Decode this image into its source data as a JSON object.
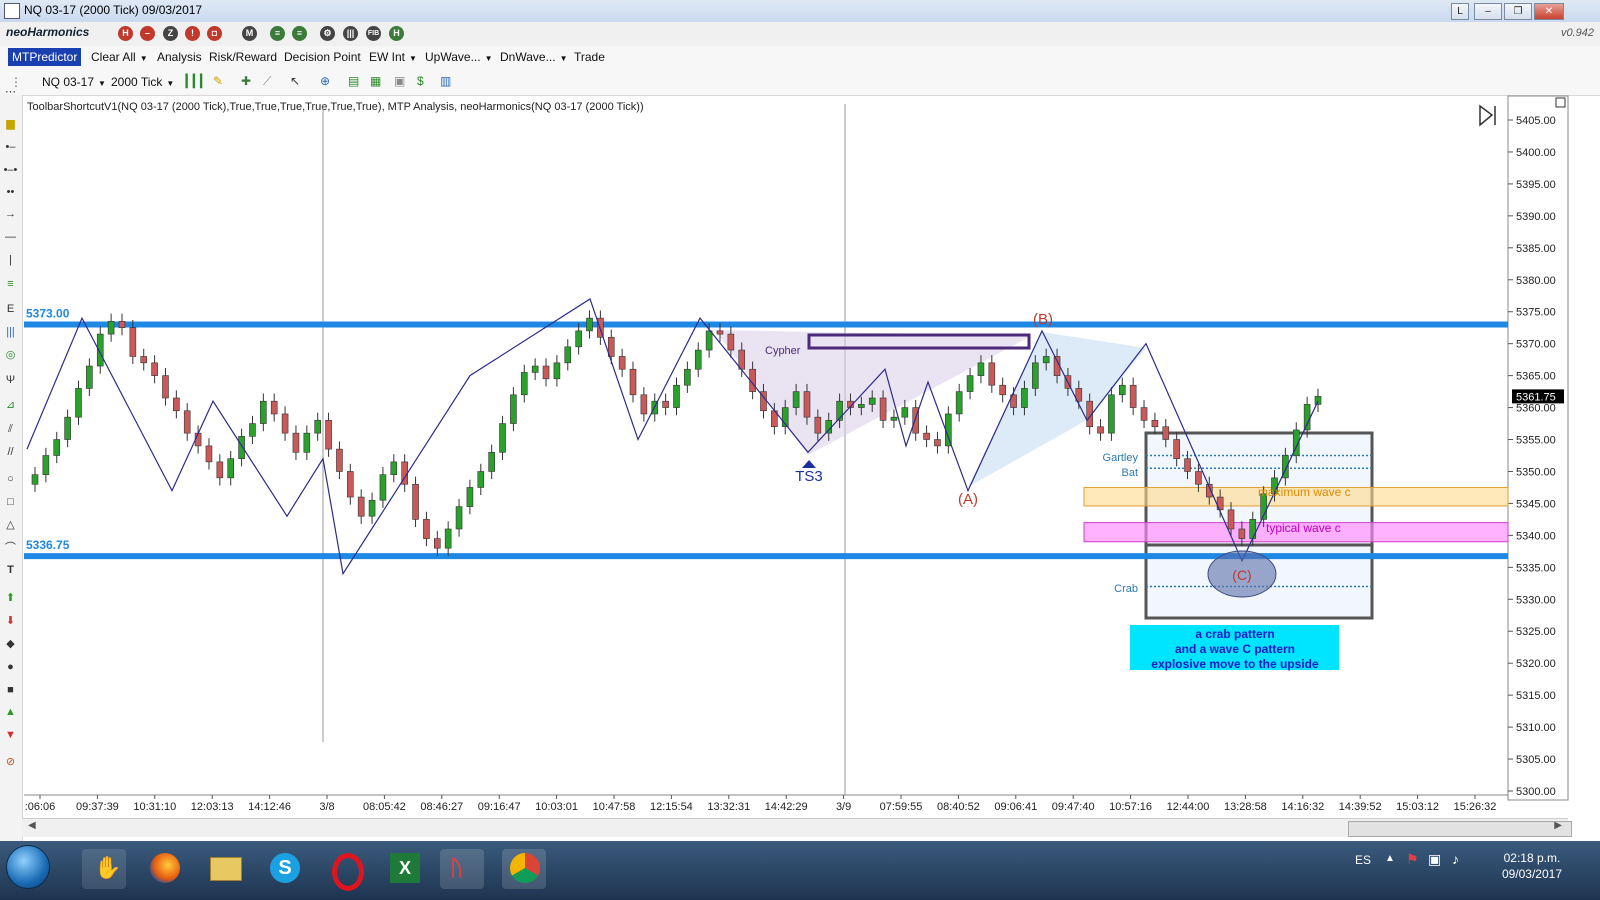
{
  "window": {
    "title": "NQ 03-17 (2000 Tick)  09/03/2017",
    "version": "v0.942",
    "controls": [
      "L",
      "–",
      "❐",
      "✕"
    ]
  },
  "toolbar1": {
    "brand": "neoHarmonics",
    "icons": [
      {
        "name": "h-icon",
        "glyph": "H"
      },
      {
        "name": "minus-icon",
        "glyph": "–"
      },
      {
        "name": "z-icon",
        "glyph": "Z"
      },
      {
        "name": "alert-icon",
        "glyph": "!"
      },
      {
        "name": "camera-icon",
        "glyph": "◘"
      },
      {
        "name": "m-icon",
        "glyph": "M"
      },
      {
        "name": "layers-icon",
        "glyph": "≡"
      },
      {
        "name": "layers2-icon",
        "glyph": "≡"
      },
      {
        "name": "tools-icon",
        "glyph": "⚙"
      },
      {
        "name": "bars-icon",
        "glyph": "|||"
      },
      {
        "name": "fib-icon",
        "glyph": "FIB"
      },
      {
        "name": "hash-icon",
        "glyph": "H"
      }
    ]
  },
  "menu": {
    "items": [
      {
        "label": "MTPredictor",
        "active": true,
        "caret": false
      },
      {
        "label": "Clear All",
        "active": false,
        "caret": true
      },
      {
        "label": "Analysis",
        "active": false,
        "caret": false
      },
      {
        "label": "Risk/Reward",
        "active": false,
        "caret": false
      },
      {
        "label": "Decision Point",
        "active": false,
        "caret": false
      },
      {
        "label": "EW Int",
        "active": false,
        "caret": true
      },
      {
        "label": "UpWave...",
        "active": false,
        "caret": true
      },
      {
        "label": "DnWave...",
        "active": false,
        "caret": true
      },
      {
        "label": "Trade",
        "active": false,
        "caret": false
      }
    ]
  },
  "toolbar3": {
    "instrument": "NQ 03-17",
    "period": "2000 Tick"
  },
  "indicator_line": "ToolbarShortcutV1(NQ 03-17 (2000 Tick),True,True,True,True,True,True), MTP Analysis, neoHarmonics(NQ 03-17 (2000 Tick))",
  "chart_data": {
    "type": "candlestick",
    "ylim": [
      5300,
      5407
    ],
    "yticks": [
      5405,
      5400,
      5395,
      5390,
      5385,
      5380,
      5375,
      5370,
      5365,
      5360,
      5355,
      5350,
      5345,
      5340,
      5335,
      5330,
      5325,
      5320,
      5315,
      5310,
      5305,
      5300
    ],
    "ytick_labels": [
      "5405.00",
      "5400.00",
      "5395.00",
      "5390.00",
      "5385.00",
      "5380.00",
      "5375.00",
      "5370.00",
      "5365.00",
      "5360.00",
      "5355.00",
      "5350.00",
      "5345.00",
      "5340.00",
      "5335.00",
      "5330.00",
      "5325.00",
      "5320.00",
      "5315.00",
      "5310.00",
      "5305.00",
      "5300.00"
    ],
    "xtick_labels": [
      ":06:06",
      "09:37:39",
      "10:31:10",
      "12:03:13",
      "14:12:46",
      "3/8",
      "08:05:42",
      "08:46:27",
      "09:16:47",
      "10:03:01",
      "10:47:58",
      "12:15:54",
      "13:32:31",
      "14:42:29",
      "3/9",
      "07:59:55",
      "08:40:52",
      "09:06:41",
      "09:47:40",
      "10:57:16",
      "12:44:00",
      "13:28:58",
      "14:16:32",
      "14:39:52",
      "15:03:12",
      "15:26:32"
    ],
    "current_price": "5361.75",
    "levels": [
      {
        "label": "5373.00",
        "value": 5373.0,
        "color": "#1e88e5"
      },
      {
        "label": "5336.75",
        "value": 5336.75,
        "color": "#1e88e5"
      }
    ],
    "closes": [
      5349.5,
      5352.5,
      5355.0,
      5358.5,
      5363.0,
      5366.5,
      5371.5,
      5373.5,
      5372.5,
      5368.0,
      5367.0,
      5365.0,
      5361.5,
      5359.5,
      5356.0,
      5354.0,
      5351.5,
      5349.0,
      5352.0,
      5355.5,
      5357.5,
      5361.0,
      5359.0,
      5356.0,
      5353.0,
      5356.0,
      5358.0,
      5353.5,
      5350.0,
      5346.0,
      5343.0,
      5345.5,
      5349.5,
      5351.5,
      5348.0,
      5342.5,
      5339.5,
      5338.0,
      5341.0,
      5344.5,
      5347.5,
      5350.0,
      5353.0,
      5357.5,
      5362.0,
      5365.5,
      5366.5,
      5364.5,
      5367.0,
      5369.5,
      5372.0,
      5374.0,
      5371.0,
      5368.0,
      5366.0,
      5362.0,
      5359.0,
      5361.0,
      5360.0,
      5363.5,
      5366.0,
      5369.0,
      5372.0,
      5371.5,
      5369.0,
      5366.0,
      5362.5,
      5359.5,
      5357.0,
      5360.0,
      5362.5,
      5358.5,
      5356.0,
      5358.0,
      5361.0,
      5360.0,
      5360.5,
      5361.5,
      5358.0,
      5358.5,
      5360.0,
      5356.0,
      5355.0,
      5354.0,
      5359.0,
      5362.5,
      5365.0,
      5367.0,
      5363.5,
      5362.0,
      5360.0,
      5363.0,
      5367.0,
      5368.0,
      5365.0,
      5363.0,
      5361.0,
      5357.0,
      5356.0,
      5362.0,
      5363.5,
      5360.0,
      5358.0,
      5357.0,
      5355.0,
      5352.0,
      5350.0,
      5348.0,
      5346.0,
      5344.0,
      5341.0,
      5339.5,
      5342.5,
      5346.5,
      5349.0,
      5352.5,
      5356.5,
      5360.5,
      5361.75
    ],
    "annotations": [
      {
        "text": "Cypher",
        "color": "#4b2a7a"
      },
      {
        "text": "TS3",
        "color": "#1a2fa0"
      },
      {
        "text": "(A)",
        "color": "#c0392b"
      },
      {
        "text": "(B)",
        "color": "#c0392b"
      },
      {
        "text": "(C)",
        "color": "#c0392b"
      },
      {
        "text": "Gartley",
        "color": "#2e7bb5"
      },
      {
        "text": "Bat",
        "color": "#2e7bb5"
      },
      {
        "text": "Crab",
        "color": "#2e7bb5"
      },
      {
        "text": "maximum wave c",
        "color": "#e08a00"
      },
      {
        "text": "typical wave c",
        "color": "#c000c0"
      }
    ],
    "note": [
      "a crab pattern",
      "and a wave C pattern",
      "explosive move to the upside"
    ],
    "colors": {
      "up": "#2ca02c",
      "down": "#c85a5a",
      "level": "#1e88e5",
      "zigzag": "#2c2c8c",
      "note_bg": "#00e5ff",
      "note_text": "#1a1acd"
    }
  },
  "taskbar": {
    "language": "ES",
    "time": "02:18 p.m.",
    "date": "09/03/2017",
    "apps": [
      "hand-app",
      "firefox-app",
      "folder-app",
      "skype-app",
      "opera-app",
      "excel-app",
      "ninjatrader-app",
      "chrome-app"
    ]
  }
}
